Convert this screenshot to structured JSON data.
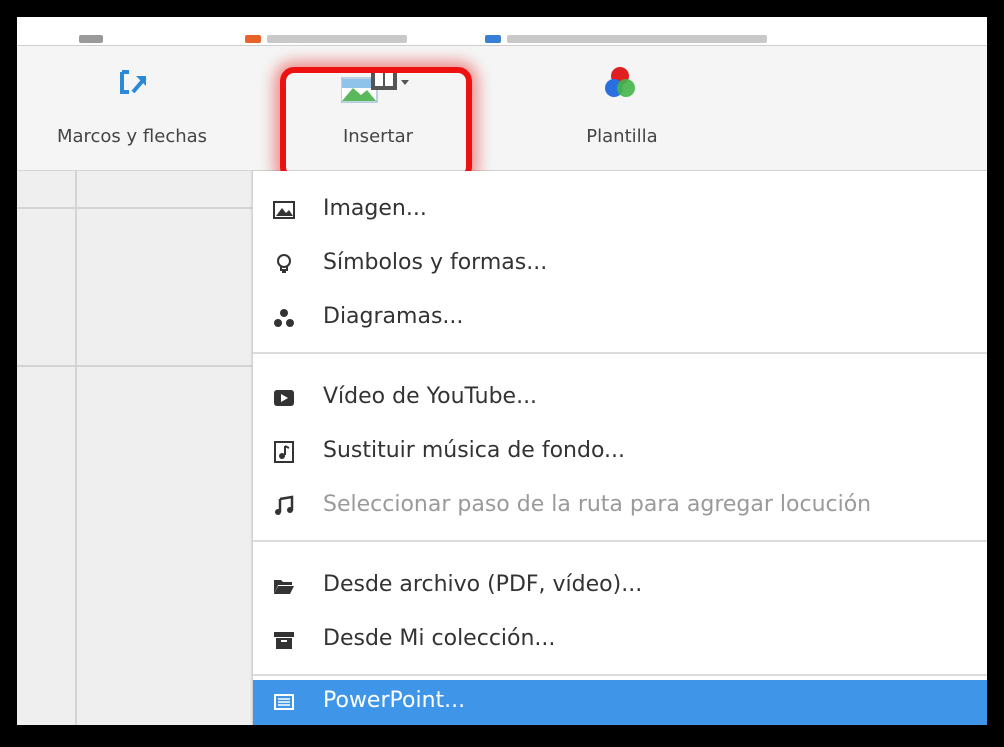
{
  "toolbar": {
    "marcos_label": "Marcos y flechas",
    "insertar_label": "Insertar",
    "plantilla_label": "Plantilla"
  },
  "menu": {
    "items": [
      {
        "label": "Imagen...",
        "icon": "image-icon"
      },
      {
        "label": "Símbolos y formas...",
        "icon": "lightbulb-icon"
      },
      {
        "label": "Diagramas...",
        "icon": "diagram-icon"
      },
      {
        "label": "Vídeo de YouTube...",
        "icon": "youtube-play-icon"
      },
      {
        "label": "Sustituir música de fondo...",
        "icon": "music-file-icon"
      },
      {
        "label": "Seleccionar paso de la ruta para agregar locución",
        "icon": "music-note-icon",
        "disabled": true
      },
      {
        "label": "Desde archivo (PDF, vídeo)...",
        "icon": "folder-open-icon"
      },
      {
        "label": "Desde Mi colección...",
        "icon": "archive-box-icon"
      },
      {
        "label": "PowerPoint...",
        "icon": "powerpoint-icon",
        "active": true
      }
    ]
  },
  "colors": {
    "accent": "#3f96e8",
    "highlight": "#e11111",
    "icon_blue": "#2a8ad8",
    "image_green": "#5cb85c"
  }
}
